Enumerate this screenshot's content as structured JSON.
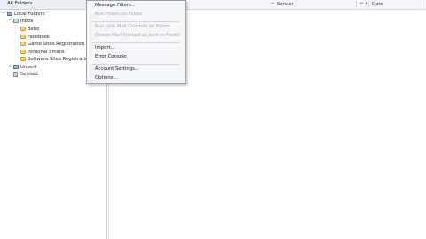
{
  "folder_pane": {
    "header": "All Folders",
    "root": {
      "label": "Local Folders",
      "twisty": "−"
    },
    "inbox": {
      "label": "Inbox",
      "twisty": "−"
    },
    "subfolders": [
      {
        "label": "Bebo"
      },
      {
        "label": "Facebook"
      },
      {
        "label": "Game Sites Registration D"
      },
      {
        "label": "Personal Emails"
      },
      {
        "label": "Software Sites Registration"
      }
    ],
    "unsent": {
      "label": "Unsent",
      "twisty": "+"
    },
    "deleted": {
      "label": "Deleted"
    }
  },
  "message_list": {
    "columns": {
      "sender": {
        "label": "Sender",
        "arrow": "⇔"
      },
      "date": {
        "label": "Date",
        "arrow": "⇔"
      },
      "flag": {
        "label": "f"
      }
    }
  },
  "menu": {
    "items": [
      {
        "label": "Message Filters...",
        "enabled": true
      },
      {
        "label": "Run Filters on Folder",
        "enabled": false
      },
      {
        "label": "Run Junk Mail Controls on Folder",
        "enabled": false
      },
      {
        "label": "Delete Mail Marked as Junk in Folder",
        "enabled": false
      },
      {
        "label": "Import...",
        "enabled": true
      },
      {
        "label": "Error Console",
        "enabled": true
      },
      {
        "label": "Account Settings...",
        "enabled": true
      },
      {
        "label": "Options...",
        "enabled": true
      }
    ]
  },
  "colors": {
    "folder_pane_header": "#eaeff5",
    "menu_background": "#f5f6f8",
    "disabled_text": "#a3a8af"
  }
}
